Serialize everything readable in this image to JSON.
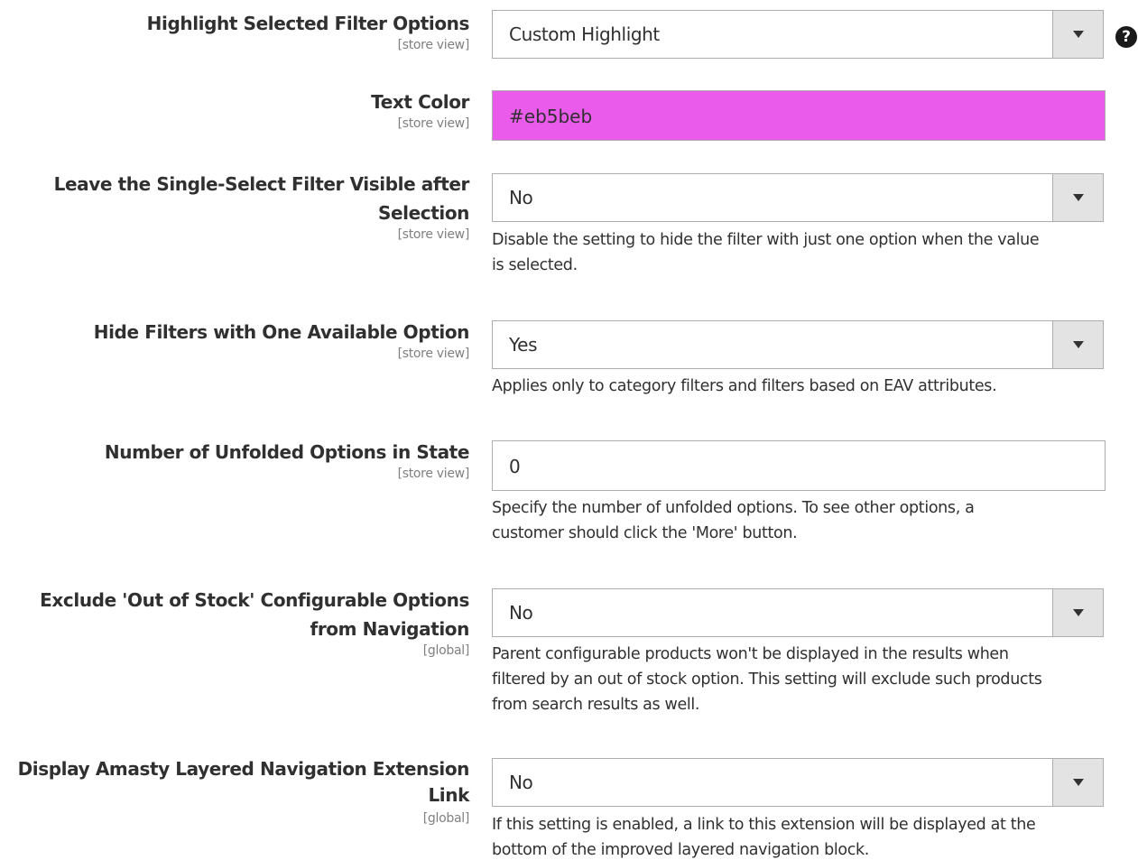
{
  "fields": [
    {
      "label": "Highlight Selected Filter Options",
      "scope": "[store view]",
      "value": "Custom Highlight",
      "note": ""
    },
    {
      "label": "Text Color",
      "scope": "[store view]",
      "value": "#eb5beb",
      "note": ""
    },
    {
      "label_line1": "Leave the Single-Select Filter Visible after",
      "label_line2": "Selection",
      "scope": "[store view]",
      "value": "No",
      "note_line1": "Disable the setting to hide the filter with just one option when the value",
      "note_line2": "is selected."
    },
    {
      "label": "Hide Filters with One Available Option",
      "scope": "[store view]",
      "value": "Yes",
      "note": "Applies only to category filters and filters based on EAV attributes."
    },
    {
      "label": "Number of Unfolded Options in State",
      "scope": "[store view]",
      "value": "0",
      "note_line1": "Specify the number of unfolded options. To see other options, a",
      "note_line2": "customer should click the 'More' button."
    },
    {
      "label_line1": "Exclude 'Out of Stock' Configurable Options",
      "label_line2": "from Navigation",
      "scope": "[global]",
      "value": "No",
      "note_line1": "Parent configurable products won't be displayed in the results when",
      "note_line2": "filtered by an out of stock option. This setting will exclude such products",
      "note_line3": "from search results as well."
    },
    {
      "label_line1": "Display Amasty Layered Navigation Extension",
      "label_line2": "Link",
      "scope": "[global]",
      "value": "No",
      "note_line1": "If this setting is enabled, a link to this extension will be displayed at the",
      "note_line2": "bottom of the improved layered navigation block."
    }
  ],
  "help_icon_glyph": "?",
  "colors": {
    "text_color_swatch": "#eb5beb",
    "select_arrow_bg": "#e3e3e3",
    "border": "#adadad"
  }
}
